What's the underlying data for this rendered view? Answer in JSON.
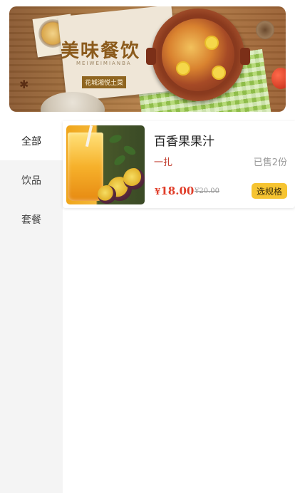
{
  "banner": {
    "title": "美味餐饮",
    "subtitle": "MEIWEIMIANBA",
    "tag": "花城湘悦土菜"
  },
  "sidebar": {
    "items": [
      {
        "label": "全部",
        "active": true
      },
      {
        "label": "饮品",
        "active": false
      },
      {
        "label": "套餐",
        "active": false
      }
    ]
  },
  "products": [
    {
      "name": "百香果果汁",
      "unit": "一扎",
      "sold": "已售2份",
      "price_symbol": "¥",
      "price": "18.00",
      "original_price": "¥20.00",
      "button_label": "选规格"
    }
  ],
  "colors": {
    "accent": "#f6c431",
    "price": "#e03c28",
    "unit": "#c0392b",
    "sidebar_bg": "#f4f4f4"
  }
}
